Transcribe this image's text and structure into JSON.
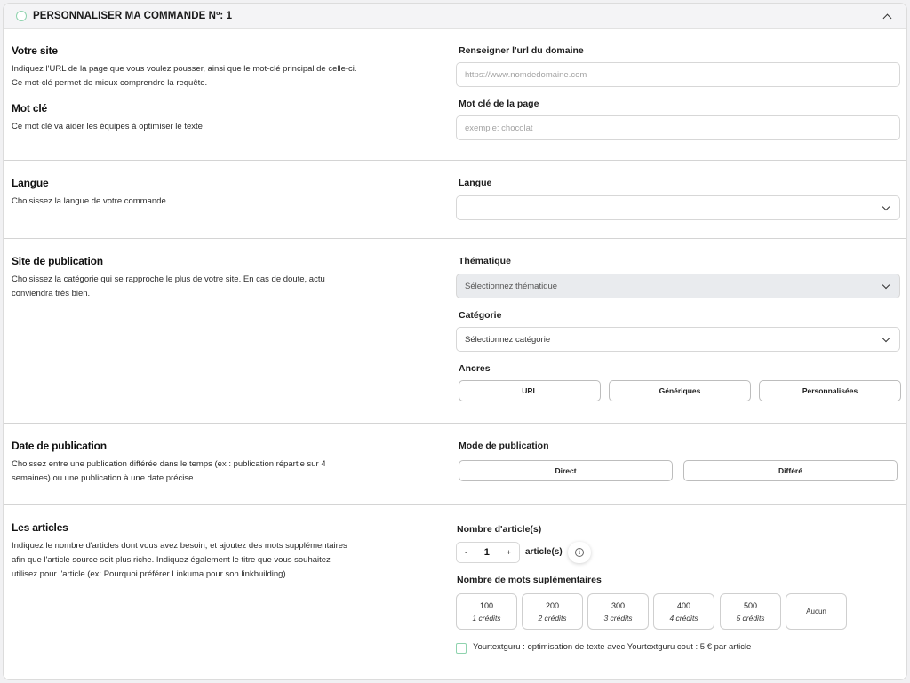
{
  "header": {
    "title": "PERSONNALISER MA COMMANDE Nº: 1"
  },
  "votre_site": {
    "title": "Votre site",
    "desc_line1": "Indiquez l'URL de la page que vous voulez pousser, ainsi que le mot-clé principal de celle-ci.",
    "desc_line2": "Ce mot-clé permet de mieux comprendre la requête.",
    "url_label": "Renseigner l'url du domaine",
    "url_placeholder": "https://www.nomdedomaine.com"
  },
  "mot_cle": {
    "title": "Mot clé",
    "desc": "Ce mot clé va aider les équipes à optimiser le texte",
    "label": "Mot clé de la page",
    "placeholder": "exemple: chocolat"
  },
  "langue": {
    "title": "Langue",
    "desc": "Choisissez la langue de votre commande.",
    "label": "Langue",
    "value": ""
  },
  "site_publication": {
    "title": "Site de publication",
    "desc_line1": "Choisissez la catégorie qui se rapproche le plus de votre site. En cas de doute, actu",
    "desc_line2": "conviendra très bien.",
    "thematique_label": "Thématique",
    "thematique_value": "Sélectionnez thématique",
    "categorie_label": "Catégorie",
    "categorie_value": "Sélectionnez catégorie",
    "ancres_label": "Ancres",
    "ancres": [
      "URL",
      "Génériques",
      "Personnalisées"
    ]
  },
  "date_publication": {
    "title": "Date de publication",
    "desc_line1": "Choissez entre une publication différée dans le temps (ex : publication répartie sur 4",
    "desc_line2": "semaines) ou une publication à une date précise.",
    "mode_label": "Mode de publication",
    "modes": [
      "Direct",
      "Différé"
    ]
  },
  "articles": {
    "title": "Les articles",
    "desc_line1": "Indiquez le nombre d'articles dont vous avez besoin, et ajoutez des mots supplémentaires",
    "desc_line2": "afin que l'article source soit plus riche. Indiquez également le titre que vous souhaitez",
    "desc_line3": "utilisez pour l'article (ex: Pourquoi préférer Linkuma pour son linkbuilding)",
    "count_label": "Nombre d'article(s)",
    "minus": "-",
    "count": "1",
    "plus": "+",
    "unit": "article(s)",
    "info_glyph": "i",
    "words_label": "Nombre de mots suplémentaires",
    "word_options": [
      {
        "value": "100",
        "credits": "1 crédits"
      },
      {
        "value": "200",
        "credits": "2 crédits"
      },
      {
        "value": "300",
        "credits": "3 crédits"
      },
      {
        "value": "400",
        "credits": "4 crédits"
      },
      {
        "value": "500",
        "credits": "5 crédits"
      }
    ],
    "none_label": "Aucun",
    "yourtextguru": "Yourtextguru : optimisation de texte avec Yourtextguru cout : 5 € par article"
  },
  "icons": [
    "radio-circle",
    "chevron-up-icon",
    "chevron-down-icon",
    "info-icon",
    "checkbox"
  ],
  "colors": {
    "accent": "#8fd3ae",
    "header_bg": "#f4f4f6",
    "disabled_bg": "#e9ebee"
  }
}
